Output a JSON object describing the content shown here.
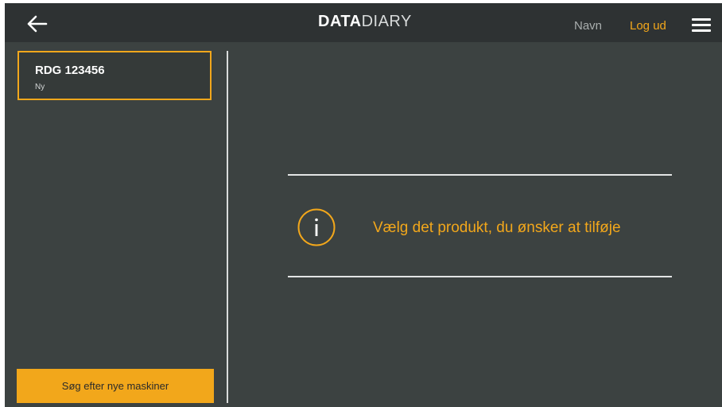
{
  "header": {
    "back_icon": "arrow-left-icon",
    "logo_bold": "DATA",
    "logo_light": "DIARY",
    "name_link": "Navn",
    "logout_link": "Log ud",
    "menu_icon": "hamburger-menu-icon"
  },
  "sidebar": {
    "machines": [
      {
        "name": "RDG 123456",
        "status": "Ny"
      }
    ],
    "search_button": "Søg efter nye maskiner"
  },
  "main": {
    "info_icon": "info-circle-icon",
    "message": "Vælg det produkt, du ønsker at tilføje"
  },
  "colors": {
    "accent": "#f2a71b",
    "header_bg": "#2e3233",
    "body_bg": "#3c4241"
  }
}
